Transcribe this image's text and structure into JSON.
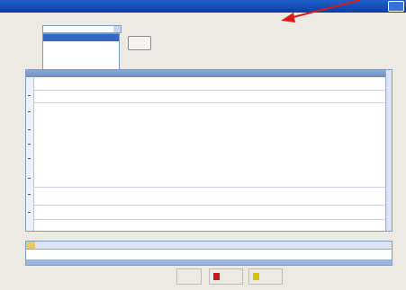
{
  "window": {
    "title": "",
    "close_icon": "close-icon"
  },
  "filters": {
    "label_1": "",
    "label_2": "",
    "label_3": "",
    "combo_value": "",
    "options": [
      "",
      "",
      "",
      "",
      "",
      ""
    ],
    "selected_index": 0,
    "side_button": ""
  },
  "grid": {
    "rows": 10
  },
  "summary": {
    "columns": [
      "",
      "",
      "",
      ""
    ],
    "total_text": ""
  },
  "buttons": {
    "first": "",
    "second": "",
    "third": ""
  },
  "colors": {
    "title_bar": "#0a3fa4",
    "selection": "#316ac5",
    "annotation_arrow": "#e01818",
    "delete_icon": "#c81818",
    "run_icon": "#d8c400"
  }
}
